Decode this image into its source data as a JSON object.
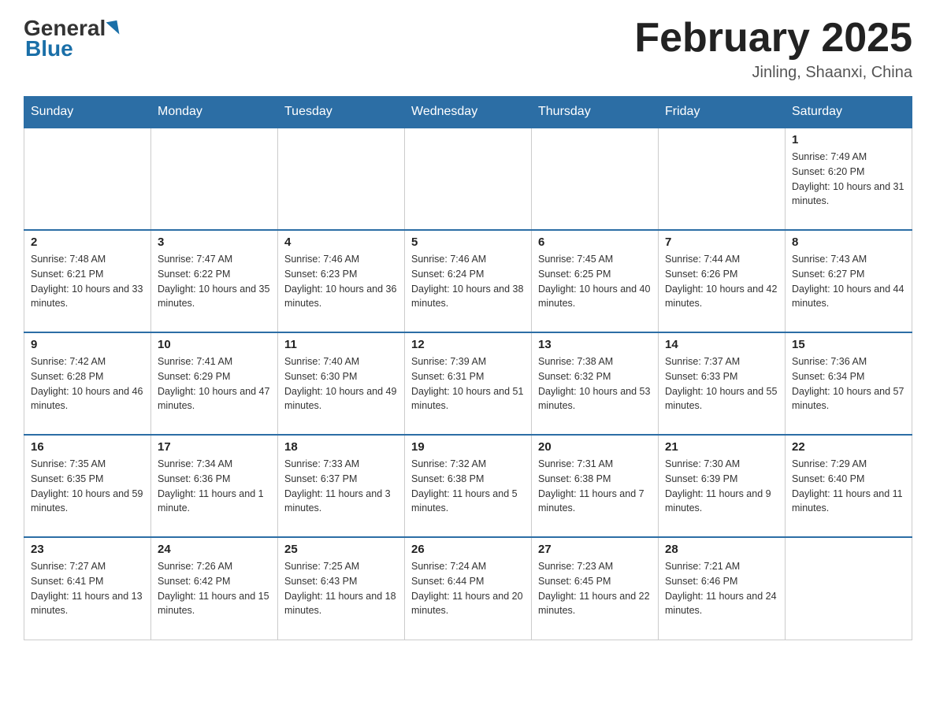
{
  "header": {
    "logo_general": "General",
    "logo_blue": "Blue",
    "month_year": "February 2025",
    "location": "Jinling, Shaanxi, China"
  },
  "days_of_week": [
    "Sunday",
    "Monday",
    "Tuesday",
    "Wednesday",
    "Thursday",
    "Friday",
    "Saturday"
  ],
  "weeks": [
    [
      {
        "day": "",
        "info": ""
      },
      {
        "day": "",
        "info": ""
      },
      {
        "day": "",
        "info": ""
      },
      {
        "day": "",
        "info": ""
      },
      {
        "day": "",
        "info": ""
      },
      {
        "day": "",
        "info": ""
      },
      {
        "day": "1",
        "info": "Sunrise: 7:49 AM\nSunset: 6:20 PM\nDaylight: 10 hours and 31 minutes."
      }
    ],
    [
      {
        "day": "2",
        "info": "Sunrise: 7:48 AM\nSunset: 6:21 PM\nDaylight: 10 hours and 33 minutes."
      },
      {
        "day": "3",
        "info": "Sunrise: 7:47 AM\nSunset: 6:22 PM\nDaylight: 10 hours and 35 minutes."
      },
      {
        "day": "4",
        "info": "Sunrise: 7:46 AM\nSunset: 6:23 PM\nDaylight: 10 hours and 36 minutes."
      },
      {
        "day": "5",
        "info": "Sunrise: 7:46 AM\nSunset: 6:24 PM\nDaylight: 10 hours and 38 minutes."
      },
      {
        "day": "6",
        "info": "Sunrise: 7:45 AM\nSunset: 6:25 PM\nDaylight: 10 hours and 40 minutes."
      },
      {
        "day": "7",
        "info": "Sunrise: 7:44 AM\nSunset: 6:26 PM\nDaylight: 10 hours and 42 minutes."
      },
      {
        "day": "8",
        "info": "Sunrise: 7:43 AM\nSunset: 6:27 PM\nDaylight: 10 hours and 44 minutes."
      }
    ],
    [
      {
        "day": "9",
        "info": "Sunrise: 7:42 AM\nSunset: 6:28 PM\nDaylight: 10 hours and 46 minutes."
      },
      {
        "day": "10",
        "info": "Sunrise: 7:41 AM\nSunset: 6:29 PM\nDaylight: 10 hours and 47 minutes."
      },
      {
        "day": "11",
        "info": "Sunrise: 7:40 AM\nSunset: 6:30 PM\nDaylight: 10 hours and 49 minutes."
      },
      {
        "day": "12",
        "info": "Sunrise: 7:39 AM\nSunset: 6:31 PM\nDaylight: 10 hours and 51 minutes."
      },
      {
        "day": "13",
        "info": "Sunrise: 7:38 AM\nSunset: 6:32 PM\nDaylight: 10 hours and 53 minutes."
      },
      {
        "day": "14",
        "info": "Sunrise: 7:37 AM\nSunset: 6:33 PM\nDaylight: 10 hours and 55 minutes."
      },
      {
        "day": "15",
        "info": "Sunrise: 7:36 AM\nSunset: 6:34 PM\nDaylight: 10 hours and 57 minutes."
      }
    ],
    [
      {
        "day": "16",
        "info": "Sunrise: 7:35 AM\nSunset: 6:35 PM\nDaylight: 10 hours and 59 minutes."
      },
      {
        "day": "17",
        "info": "Sunrise: 7:34 AM\nSunset: 6:36 PM\nDaylight: 11 hours and 1 minute."
      },
      {
        "day": "18",
        "info": "Sunrise: 7:33 AM\nSunset: 6:37 PM\nDaylight: 11 hours and 3 minutes."
      },
      {
        "day": "19",
        "info": "Sunrise: 7:32 AM\nSunset: 6:38 PM\nDaylight: 11 hours and 5 minutes."
      },
      {
        "day": "20",
        "info": "Sunrise: 7:31 AM\nSunset: 6:38 PM\nDaylight: 11 hours and 7 minutes."
      },
      {
        "day": "21",
        "info": "Sunrise: 7:30 AM\nSunset: 6:39 PM\nDaylight: 11 hours and 9 minutes."
      },
      {
        "day": "22",
        "info": "Sunrise: 7:29 AM\nSunset: 6:40 PM\nDaylight: 11 hours and 11 minutes."
      }
    ],
    [
      {
        "day": "23",
        "info": "Sunrise: 7:27 AM\nSunset: 6:41 PM\nDaylight: 11 hours and 13 minutes."
      },
      {
        "day": "24",
        "info": "Sunrise: 7:26 AM\nSunset: 6:42 PM\nDaylight: 11 hours and 15 minutes."
      },
      {
        "day": "25",
        "info": "Sunrise: 7:25 AM\nSunset: 6:43 PM\nDaylight: 11 hours and 18 minutes."
      },
      {
        "day": "26",
        "info": "Sunrise: 7:24 AM\nSunset: 6:44 PM\nDaylight: 11 hours and 20 minutes."
      },
      {
        "day": "27",
        "info": "Sunrise: 7:23 AM\nSunset: 6:45 PM\nDaylight: 11 hours and 22 minutes."
      },
      {
        "day": "28",
        "info": "Sunrise: 7:21 AM\nSunset: 6:46 PM\nDaylight: 11 hours and 24 minutes."
      },
      {
        "day": "",
        "info": ""
      }
    ]
  ]
}
